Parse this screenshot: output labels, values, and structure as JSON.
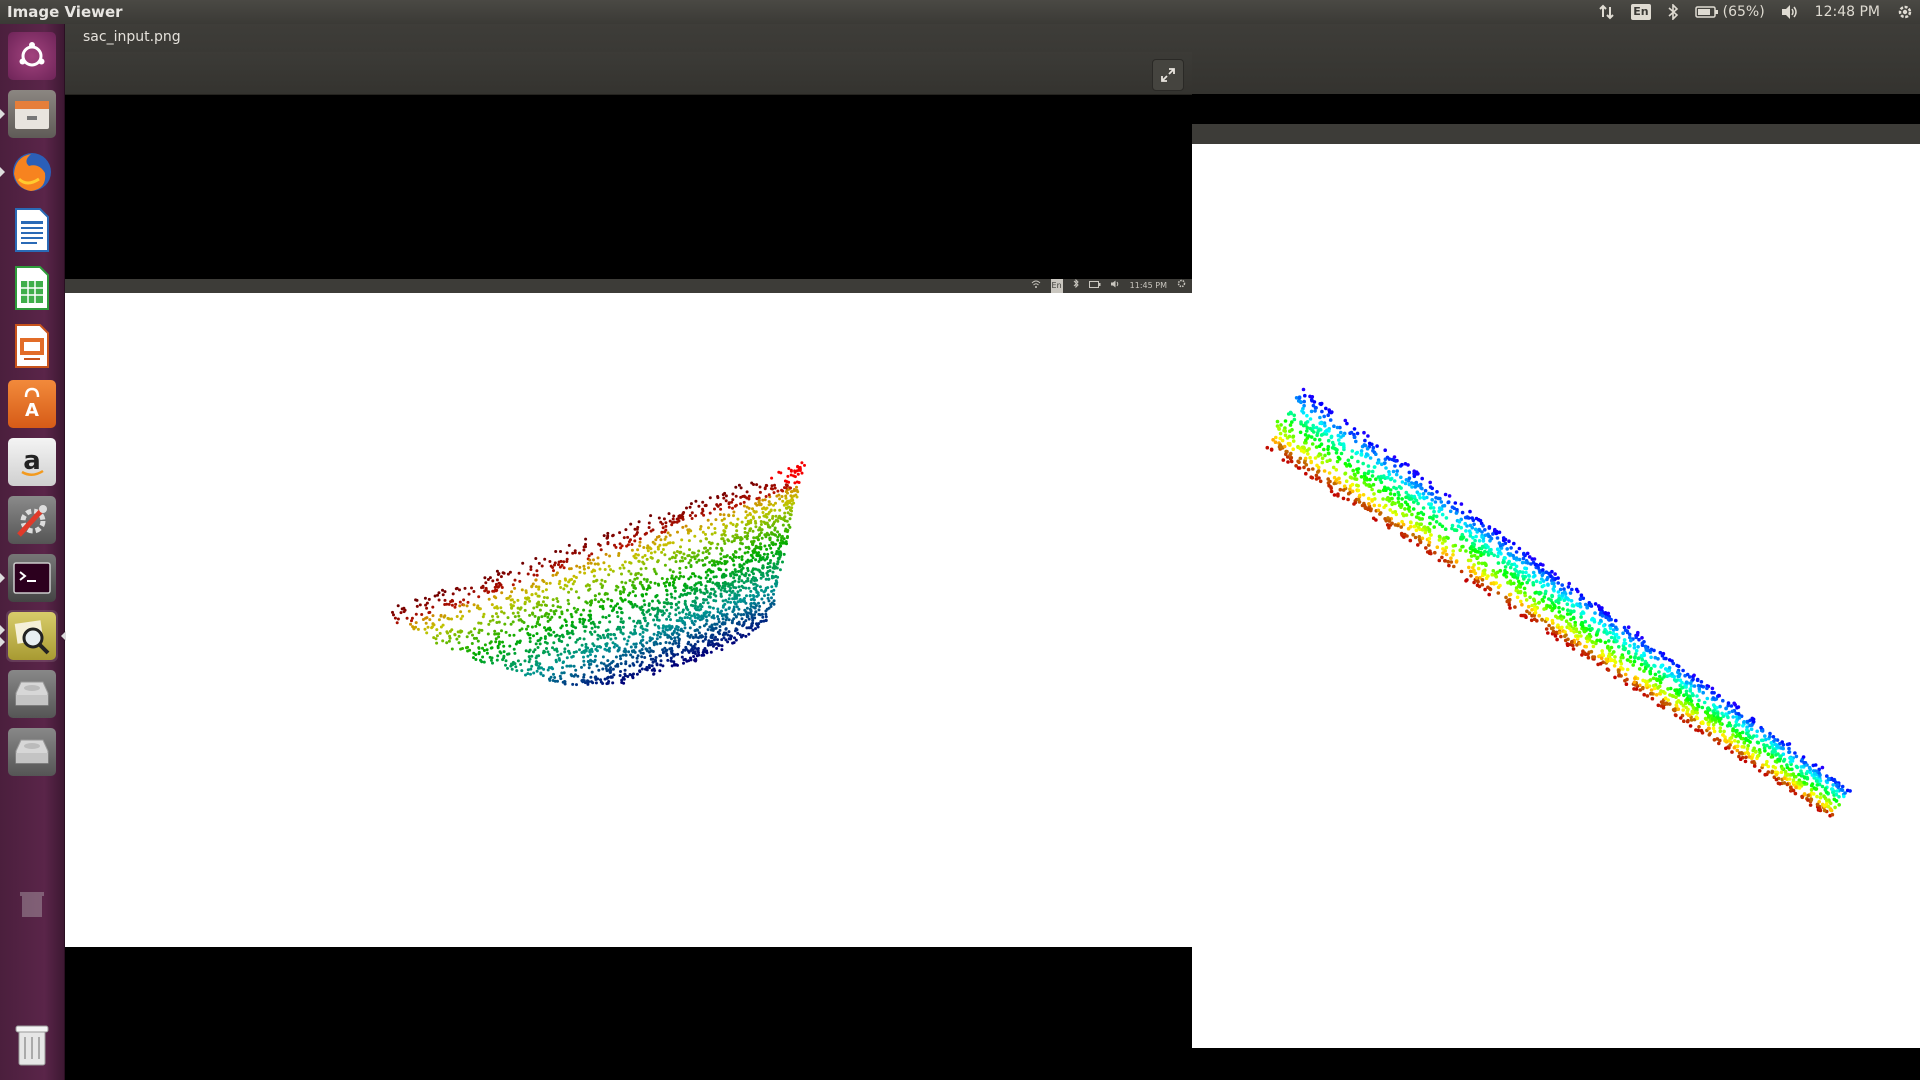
{
  "app_title": "Image Viewer",
  "panel": {
    "keyboard_layout": "En",
    "battery_percent": "(65%)",
    "clock": "12:48 PM",
    "icons": [
      "network-arrows-icon",
      "keyboard-icon",
      "bluetooth-icon",
      "battery-icon",
      "volume-icon",
      "gear-icon"
    ]
  },
  "launcher": {
    "items": [
      {
        "name": "dash-home",
        "icon": "ubuntu-logo-icon"
      },
      {
        "name": "files",
        "icon": "files-icon"
      },
      {
        "name": "firefox",
        "icon": "firefox-icon"
      },
      {
        "name": "libreoffice-writer",
        "icon": "writer-icon"
      },
      {
        "name": "libreoffice-calc",
        "icon": "calc-icon"
      },
      {
        "name": "libreoffice-impress",
        "icon": "impress-icon"
      },
      {
        "name": "software-center",
        "icon": "software-center-icon"
      },
      {
        "name": "amazon",
        "icon": "amazon-icon"
      },
      {
        "name": "system-settings",
        "icon": "settings-icon"
      },
      {
        "name": "terminal",
        "icon": "terminal-icon"
      },
      {
        "name": "image-viewer",
        "icon": "image-viewer-icon"
      },
      {
        "name": "drive-1",
        "icon": "drive-icon"
      },
      {
        "name": "drive-2",
        "icon": "drive-icon"
      },
      {
        "name": "trash",
        "icon": "trash-icon"
      }
    ]
  },
  "viewer": {
    "filename": "sac_input.png",
    "fullscreen_icon": "fullscreen-icon",
    "inner_panel": {
      "keyboard_layout": "En",
      "clock": "11:45 PM"
    }
  },
  "colors": {
    "launcher": "#5a2549",
    "panel": "#3b3a36",
    "rainbow": [
      "#8b0000",
      "#ff0000",
      "#ff7f00",
      "#ffff00",
      "#00ff00",
      "#00ffff",
      "#0000ff",
      "#4b0082"
    ]
  }
}
